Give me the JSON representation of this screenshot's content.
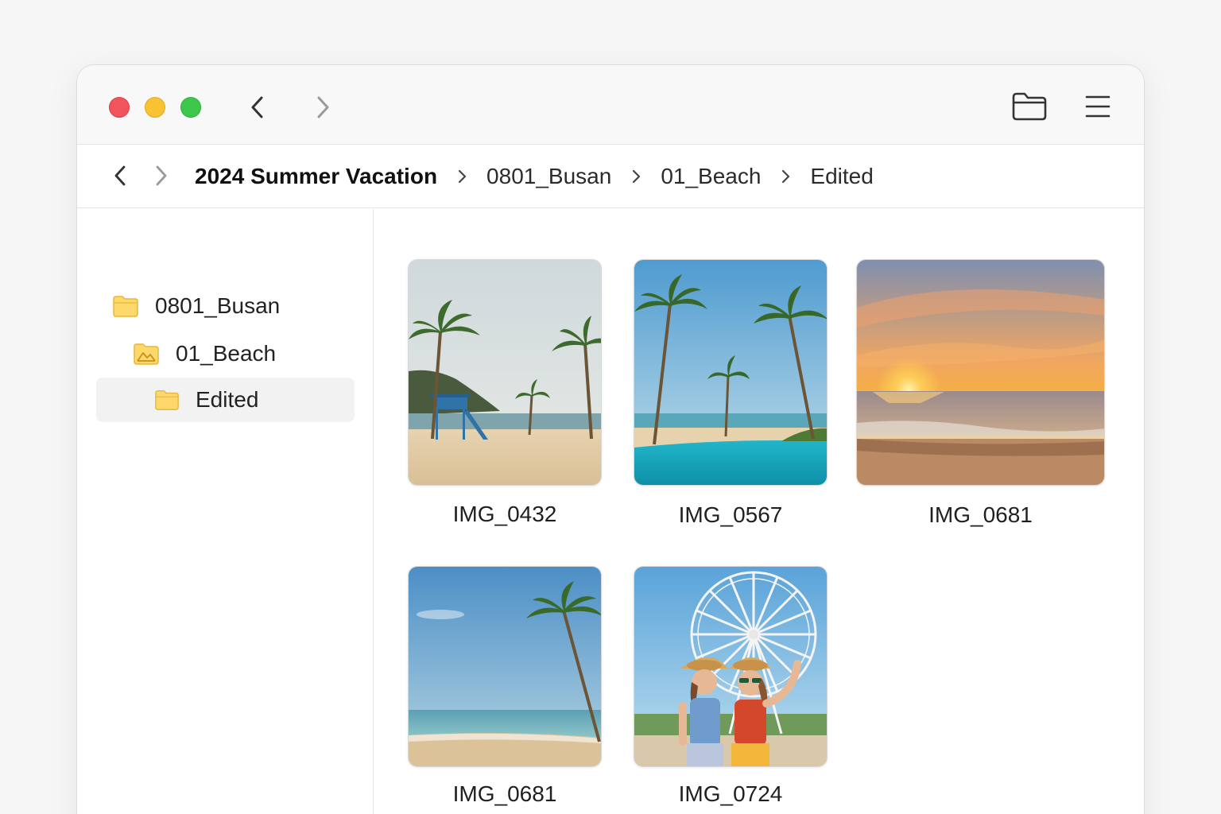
{
  "window": {
    "traffic_lights": [
      {
        "name": "close",
        "color": "#f2545b"
      },
      {
        "name": "minimize",
        "color": "#f8c232"
      },
      {
        "name": "zoom",
        "color": "#3dc84b"
      }
    ],
    "toolbar_icons": [
      "chevron-left-icon",
      "chevron-right-icon",
      "folder-icon",
      "hamburger-menu-icon"
    ]
  },
  "breadcrumb": {
    "items": [
      "2024 Summer Vacation",
      "0801_Busan",
      "01_Beach",
      "Edited"
    ]
  },
  "sidebar": {
    "items": [
      {
        "label": "0801_Busan",
        "icon": "folder-icon"
      },
      {
        "label": "01_Beach",
        "icon": "photo-folder-icon"
      },
      {
        "label": "Edited",
        "icon": "folder-icon",
        "selected": true
      }
    ]
  },
  "files": [
    {
      "name": "IMG_0432",
      "thumbnail": "beach-lifeguard-tower"
    },
    {
      "name": "IMG_0567",
      "thumbnail": "palm-pool"
    },
    {
      "name": "IMG_0681",
      "thumbnail": "sunset-sea"
    },
    {
      "name": "IMG_0681",
      "thumbnail": "palm-beach"
    },
    {
      "name": "IMG_0724",
      "thumbnail": "ferris-wheel-friends"
    }
  ],
  "colors": {
    "folder": "#f9cf4f",
    "selection": "#f2f2f2"
  }
}
